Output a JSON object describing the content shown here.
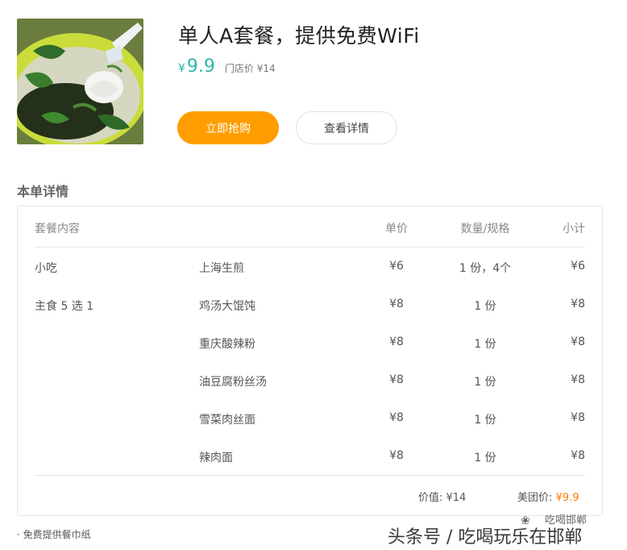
{
  "product": {
    "title": "单人A套餐，提供免费WiFi",
    "currency": "¥",
    "price": "9.9",
    "original_price": "门店价 ¥14"
  },
  "buttons": {
    "buy": "立即抢购",
    "details": "查看详情"
  },
  "details": {
    "section_title": "本单详情",
    "columns": [
      "套餐内容",
      "单价",
      "数量/规格",
      "小计"
    ],
    "rows": [
      {
        "category": "小吃",
        "name": "上海生煎",
        "unit": "¥6",
        "qty": "1 份，4个",
        "subtotal": "¥6"
      },
      {
        "category": "主食 5 选 1",
        "name": "鸡汤大馄饨",
        "unit": "¥8",
        "qty": "1 份",
        "subtotal": "¥8"
      },
      {
        "category": "",
        "name": "重庆酸辣粉",
        "unit": "¥8",
        "qty": "1 份",
        "subtotal": "¥8"
      },
      {
        "category": "",
        "name": "油豆腐粉丝汤",
        "unit": "¥8",
        "qty": "1 份",
        "subtotal": "¥8"
      },
      {
        "category": "",
        "name": "雪菜肉丝面",
        "unit": "¥8",
        "qty": "1 份",
        "subtotal": "¥8"
      },
      {
        "category": "",
        "name": "辣肉面",
        "unit": "¥8",
        "qty": "1 份",
        "subtotal": "¥8"
      }
    ],
    "value_label": "价值: ¥14",
    "meituan_label": "美团价:",
    "meituan_price": "¥9.9"
  },
  "note": "· 免费提供餐巾纸",
  "watermark": {
    "main": "头条号 / 吃喝玩乐在邯郸",
    "small": "吃喝邯郸",
    "icon": "wechat-icon"
  },
  "colors": {
    "accent_orange": "#ff9d00",
    "price_teal": "#2bb8aa",
    "meituan_orange": "#ff7a00"
  }
}
